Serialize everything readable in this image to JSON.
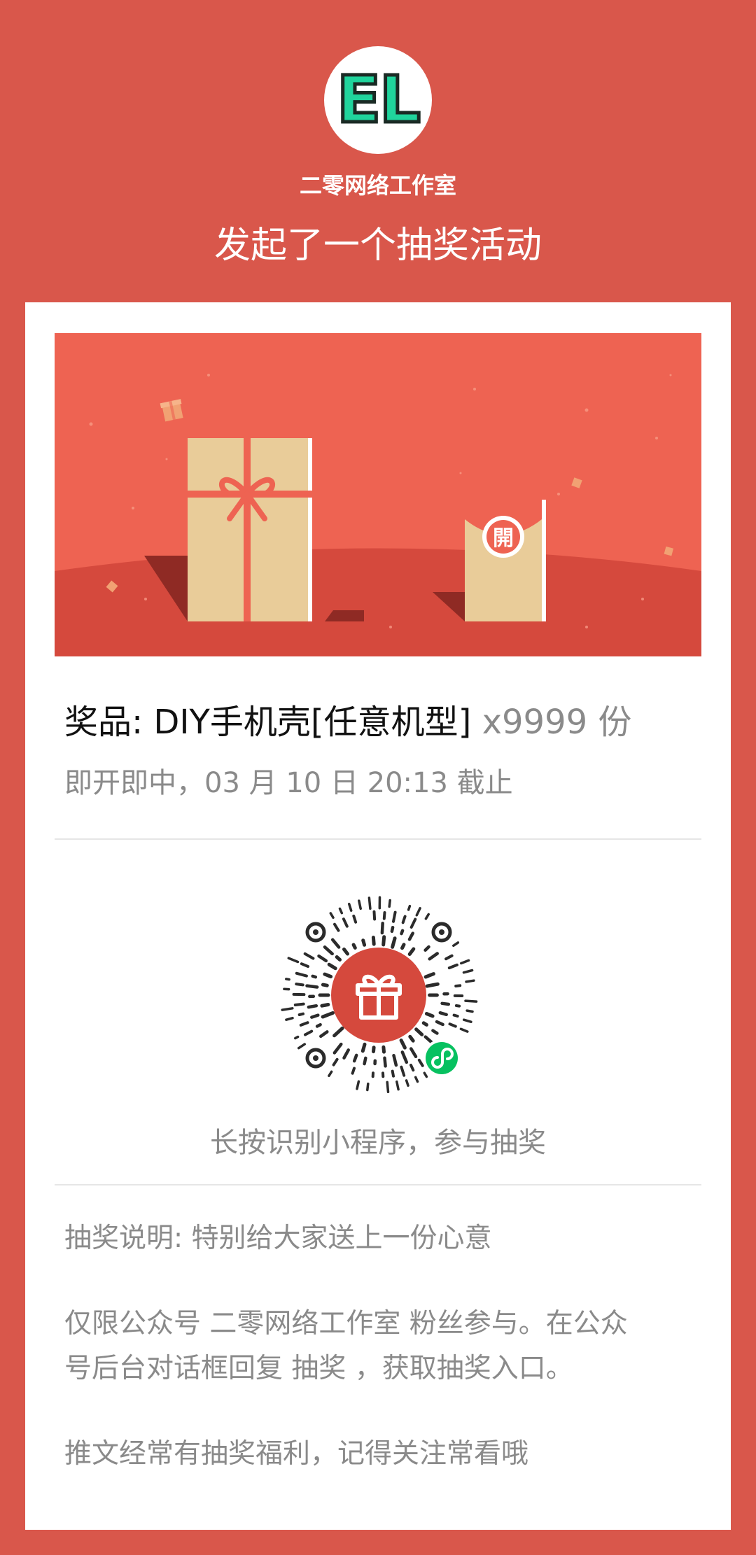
{
  "header": {
    "avatar_text": "EL",
    "org_name": "二零网络工作室",
    "headline": "发起了一个抽奖活动"
  },
  "card": {
    "banner_badge": "開",
    "prize_label": "奖品: DIY手机壳[任意机型]",
    "prize_qty": "x9999 份",
    "deadline": "即开即中，03 月 10 日 20:13 截止",
    "qr_hint": "长按识别小程序，参与抽奖",
    "desc_title": "抽奖说明: 特别给大家送上一份心意",
    "desc_rules_line1": "仅限公众号 二零网络工作室 粉丝参与。在公众",
    "desc_rules_line2": "号后台对话框回复 抽奖 ，获取抽奖入口。",
    "desc_note": "推文经常有抽奖福利，记得关注常看哦"
  },
  "colors": {
    "page_background": "#D9574B",
    "banner_background": "#EE6352",
    "gift_box": "#E9CC99",
    "ribbon": "#EE6352",
    "avatar_accent": "#20D49C",
    "miniprogram_badge": "#07C160"
  },
  "icons": {
    "gift_icon": "gift-icon",
    "miniprogram_icon": "miniprogram-link-icon"
  }
}
